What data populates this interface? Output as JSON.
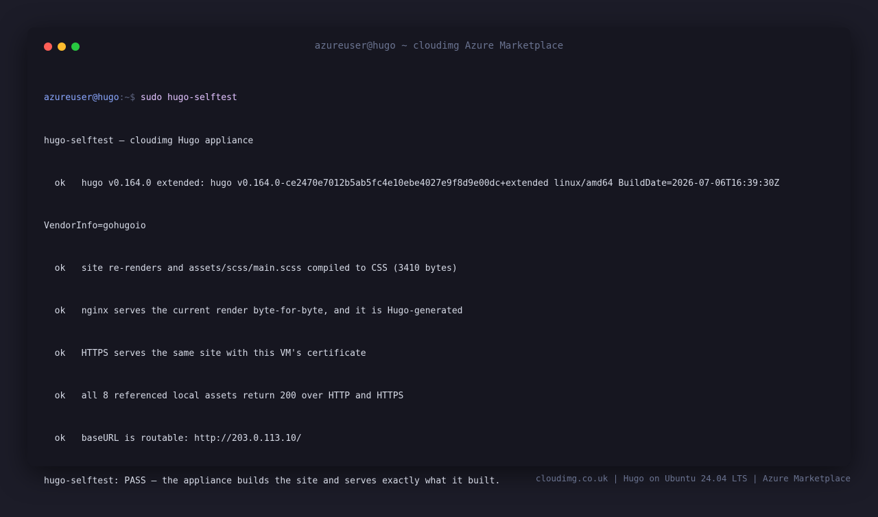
{
  "window": {
    "title": "azureuser@hugo ~ cloudimg Azure Marketplace"
  },
  "terminal": {
    "prompt_user": "azureuser@hugo",
    "prompt_sep": ":~$ ",
    "command": "sudo hugo-selftest",
    "lines": [
      "hugo-selftest — cloudimg Hugo appliance",
      "  ok   hugo v0.164.0 extended: hugo v0.164.0-ce2470e7012b5ab5fc4e10ebe4027e9f8d9e00dc+extended linux/amd64 BuildDate=2026-07-06T16:39:30Z",
      "VendorInfo=gohugoio",
      "  ok   site re-renders and assets/scss/main.scss compiled to CSS (3410 bytes)",
      "  ok   nginx serves the current render byte-for-byte, and it is Hugo-generated",
      "  ok   HTTPS serves the same site with this VM's certificate",
      "  ok   all 8 referenced local assets return 200 over HTTP and HTTPS",
      "  ok   baseURL is routable: http://203.0.113.10/",
      "hugo-selftest: PASS — the appliance builds the site and serves exactly what it built."
    ]
  },
  "footer": {
    "text": "cloudimg.co.uk | Hugo on Ubuntu 24.04 LTS | Azure Marketplace"
  },
  "colors": {
    "close": "#ff5f57",
    "minimize": "#febc2e",
    "maximize": "#28c840",
    "prompt": "#8aa7ff",
    "command": "#e2c3ff"
  }
}
